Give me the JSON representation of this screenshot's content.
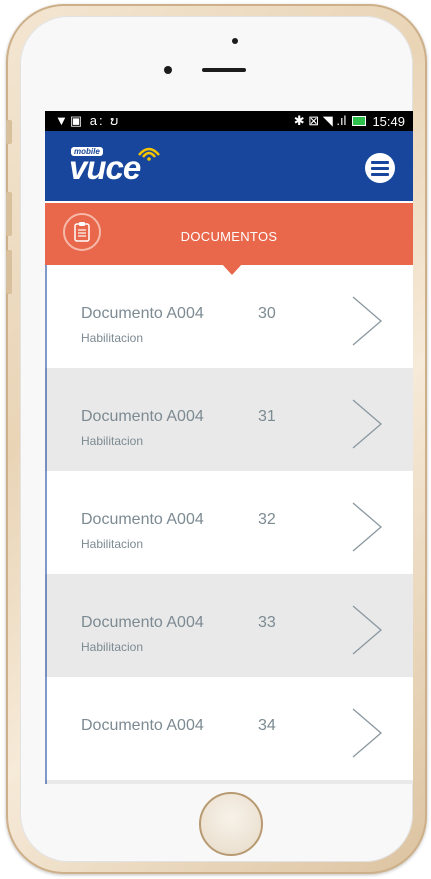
{
  "status_bar": {
    "left_icons": "▼▣ a: ບ",
    "right_icons": "✱ ⊠ ◥ .ıl",
    "time": "15:49"
  },
  "app": {
    "logo_small": "mobile",
    "logo_main": "vuce"
  },
  "section": {
    "title": "DOCUMENTOS"
  },
  "documents": [
    {
      "name": "Documento A004",
      "number": "30",
      "type": "Habilitacion"
    },
    {
      "name": "Documento A004",
      "number": "31",
      "type": "Habilitacion"
    },
    {
      "name": "Documento A004",
      "number": "32",
      "type": "Habilitacion"
    },
    {
      "name": "Documento A004",
      "number": "33",
      "type": "Habilitacion"
    },
    {
      "name": "Documento A004",
      "number": "34",
      "type": ""
    }
  ],
  "colors": {
    "appbar": "#17469c",
    "accent": "#e9674a",
    "row_alt": "#e9e9e9",
    "text_muted": "#7c8a92"
  },
  "icons": {
    "menu": "hamburger-circle-icon",
    "section": "clipboard-icon",
    "row": "chevron-right-icon"
  }
}
